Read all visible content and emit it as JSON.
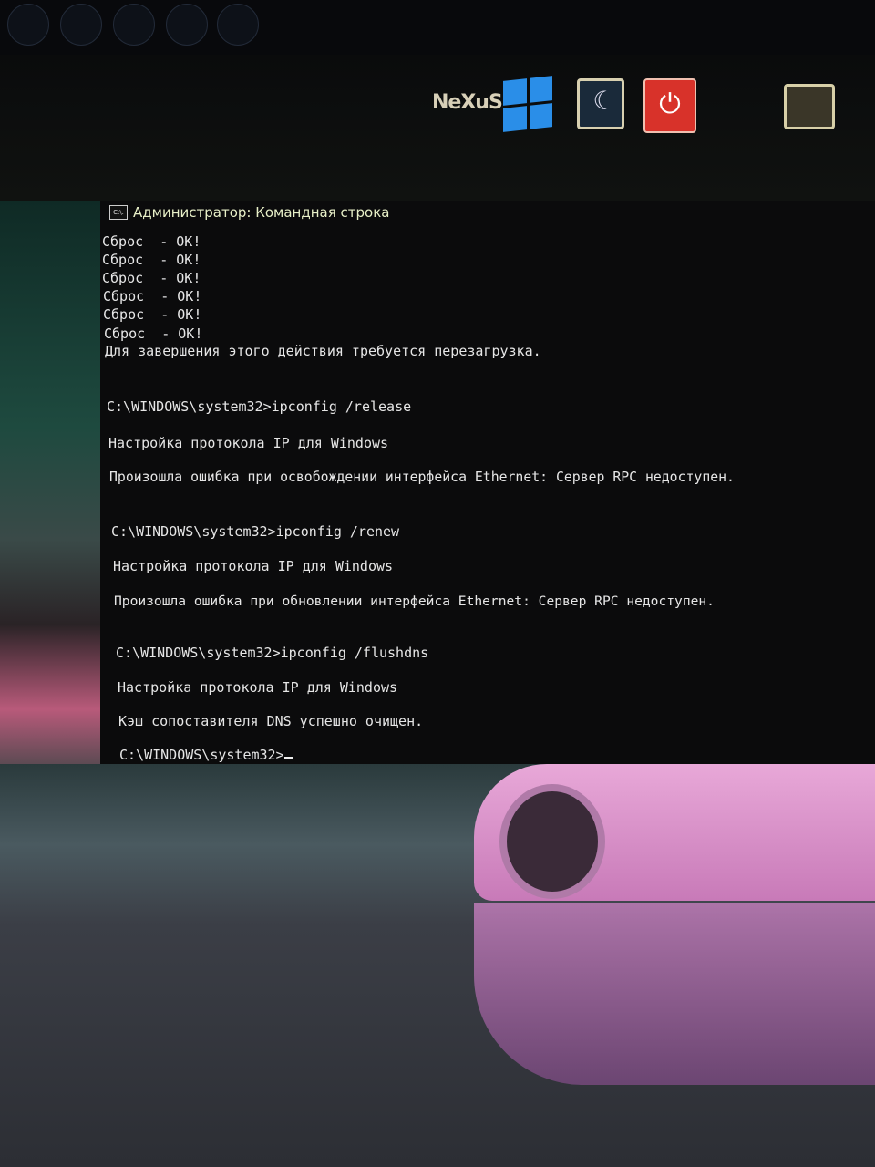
{
  "desktop": {
    "dock_icons": [
      "nexus-logo",
      "windows-icon",
      "sleep-icon",
      "power-icon",
      "device-icon"
    ],
    "nexus_label": "NeXuS",
    "colors": {
      "windows": "#2a8ee8",
      "power": "#d8322a",
      "terminal_bg": "#0b0b0c",
      "terminal_text": "#e6e6e6"
    }
  },
  "window": {
    "title": "Администратор: Командная строка",
    "icon_label": "C:\\."
  },
  "console": {
    "lines": [
      "Сброс  - OK!",
      "Сброс  - OK!",
      "Сброс  - OK!",
      "Сброс  - OK!",
      "Сброс  - OK!",
      "Сброс  - OK!",
      "Для завершения этого действия требуется перезагрузка.",
      "C:\\WINDOWS\\system32>ipconfig /release",
      "Настройка протокола IP для Windows",
      "Произошла ошибка при освобождении интерфейса Ethernet: Сервер RPC недоступен.",
      "C:\\WINDOWS\\system32>ipconfig /renew",
      "Настройка протокола IP для Windows",
      "Произошла ошибка при обновлении интерфейса Ethernet: Сервер RPC недоступен.",
      "C:\\WINDOWS\\system32>ipconfig /flushdns",
      "Настройка протокола IP для Windows",
      "Кэш сопоставителя DNS успешно очищен.",
      "C:\\WINDOWS\\system32>"
    ]
  }
}
